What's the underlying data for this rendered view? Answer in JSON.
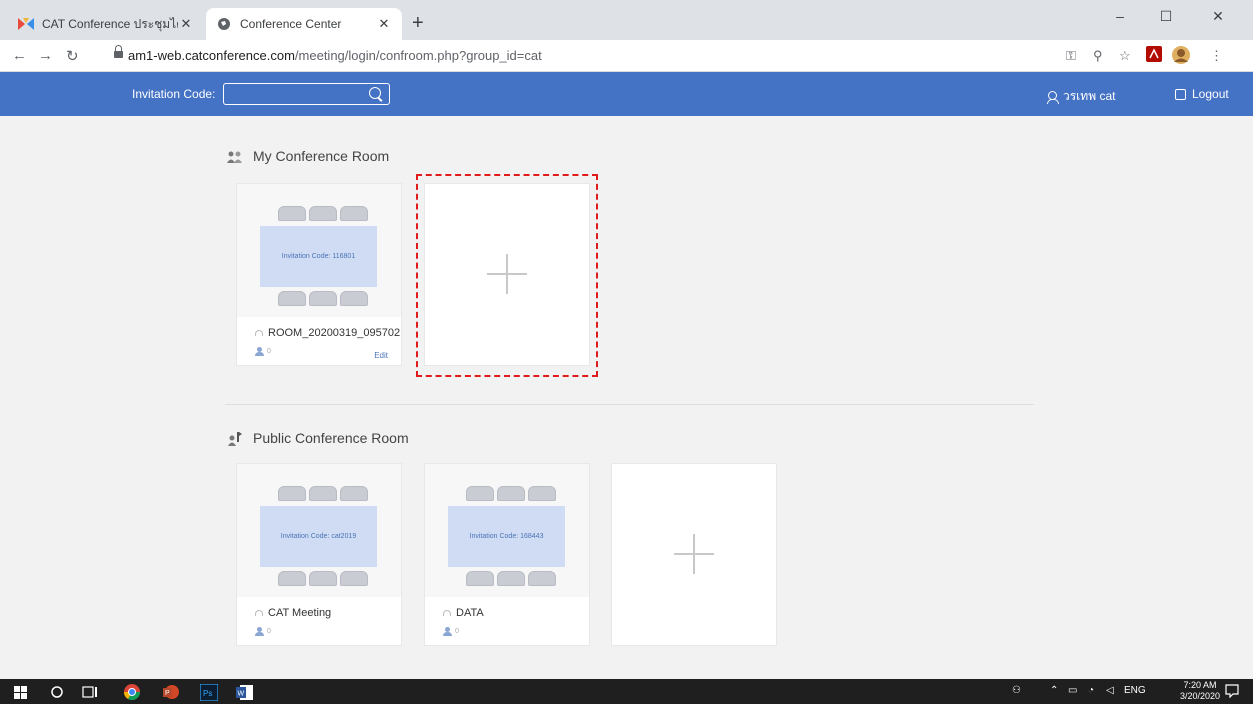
{
  "browser": {
    "tabs": [
      {
        "label": "CAT Conference ประชุมได้ไร้ข้อจำกั",
        "active": false
      },
      {
        "label": "Conference Center",
        "active": true
      }
    ],
    "url_host": "am1-web.catconference.com",
    "url_path": "/meeting/login/confroom.php?group_id=cat"
  },
  "header": {
    "invitation_label": "Invitation Code:",
    "invitation_value": "",
    "user_name": "วรเทพ cat",
    "logout_label": "Logout"
  },
  "my_rooms": {
    "title": "My Conference Room",
    "rooms": [
      {
        "invitation": "Invitation Code:  116801",
        "name": "ROOM_20200319_095702",
        "count": "0",
        "edit_label": "Edit"
      }
    ]
  },
  "public_rooms": {
    "title": "Public Conference Room",
    "rooms": [
      {
        "invitation": "Invitation Code:  cat2019",
        "name": "CAT Meeting",
        "count": "0"
      },
      {
        "invitation": "Invitation Code:  168443",
        "name": "DATA",
        "count": "0"
      }
    ]
  },
  "taskbar": {
    "lang": "ENG",
    "time": "7:20 AM",
    "date": "3/20/2020"
  },
  "colors": {
    "header": "#4472c4",
    "highlight": "#e01b1b",
    "table": "#d0dcf3"
  }
}
